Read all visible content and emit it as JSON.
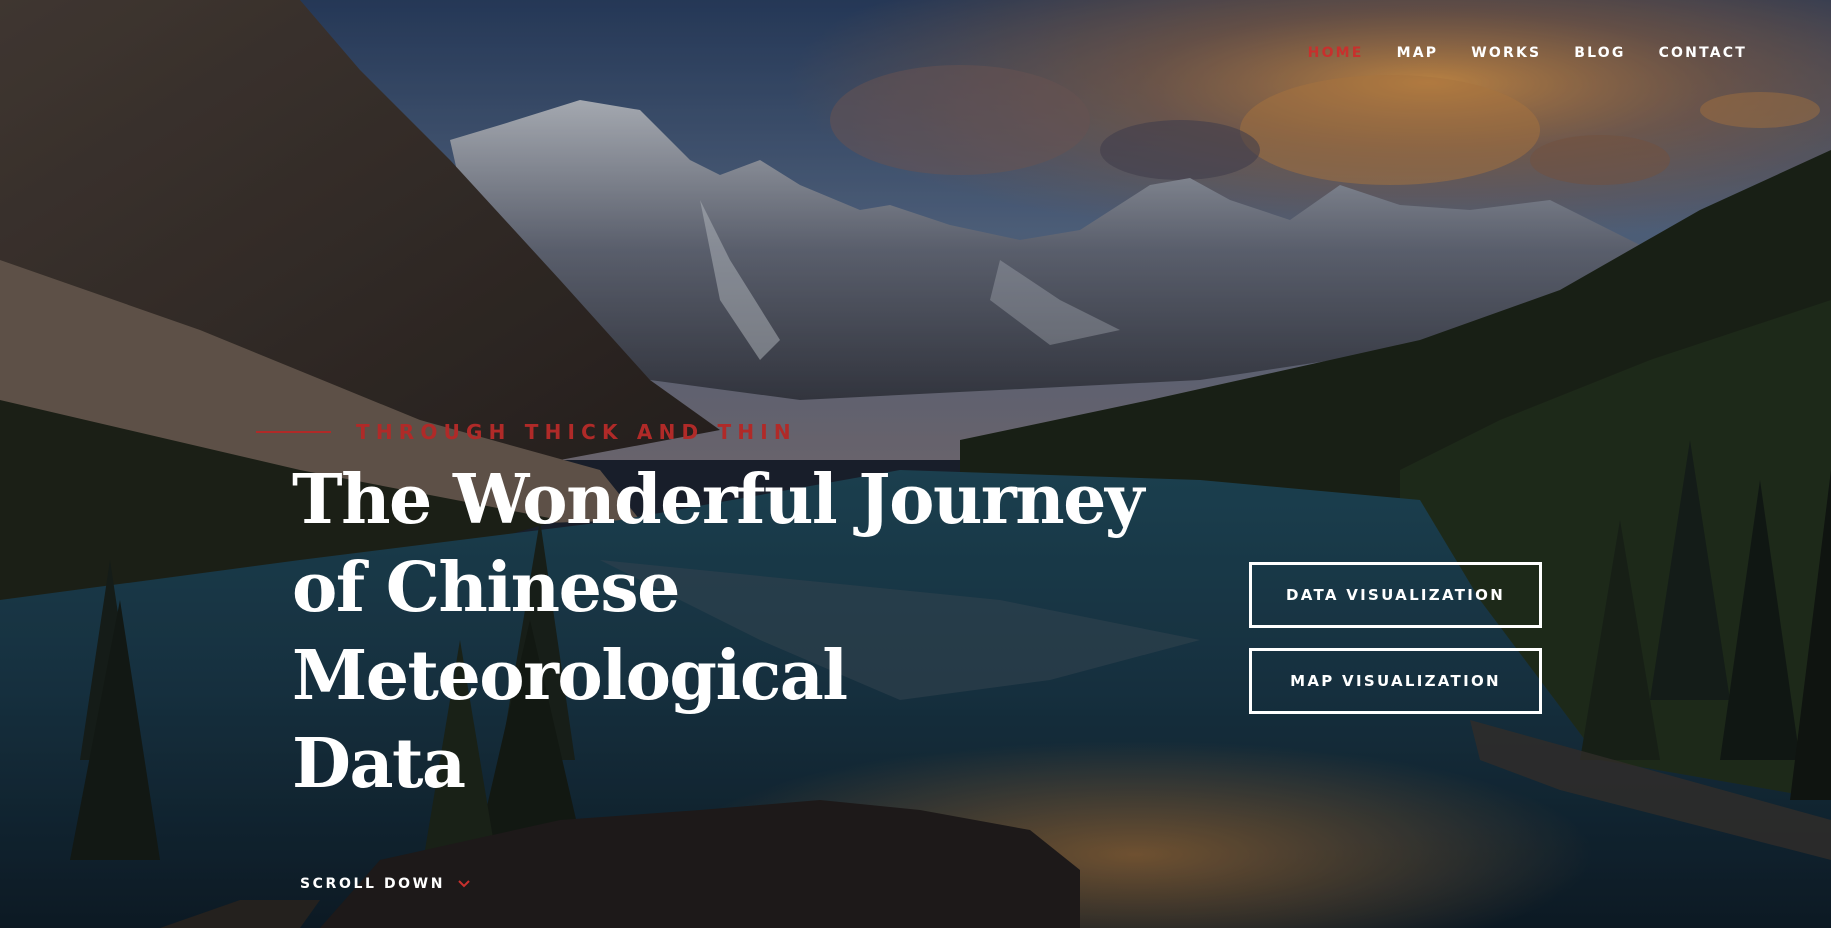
{
  "nav": {
    "items": [
      {
        "label": "HOME",
        "active": true
      },
      {
        "label": "MAP",
        "active": false
      },
      {
        "label": "WORKS",
        "active": false
      },
      {
        "label": "BLOG",
        "active": false
      },
      {
        "label": "CONTACT",
        "active": false
      }
    ]
  },
  "hero": {
    "eyebrow": "THROUGH THICK AND THIN",
    "title_lines": [
      "The Wonderful Journey",
      "of Chinese Meteorological",
      "Data"
    ],
    "buttons": {
      "data_visualization": "DATA VISUALIZATION",
      "map_visualization": "MAP VISUALIZATION"
    },
    "scroll_label": "SCROLL DOWN"
  },
  "colors": {
    "accent": "#c8302d",
    "eyebrow": "#b02a28",
    "text": "#ffffff"
  },
  "icons": {
    "scroll": "chevron-down-icon",
    "background": "mountain-lake-sunset-photo"
  }
}
